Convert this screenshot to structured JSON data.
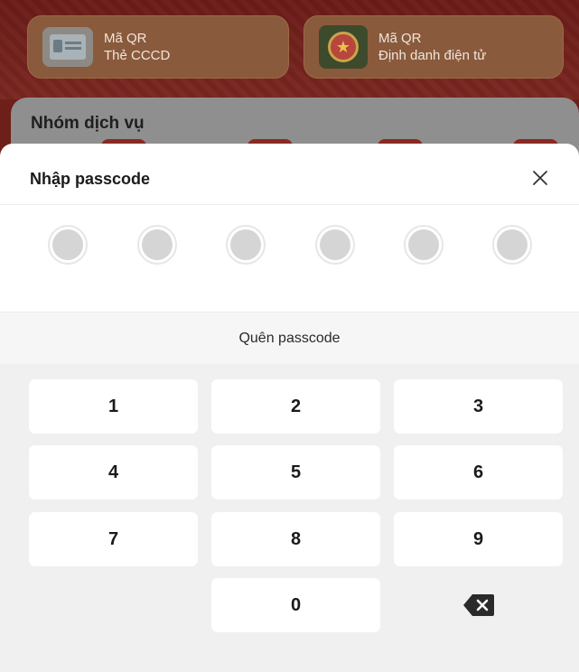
{
  "background": {
    "qr_cards": [
      {
        "title": "Mã QR",
        "subtitle": "Thẻ CCCD",
        "icon": "id-card-icon"
      },
      {
        "title": "Mã QR",
        "subtitle": "Định danh điện tử",
        "icon": "national-emblem-icon"
      }
    ],
    "service_group_title": "Nhóm dịch vụ"
  },
  "passcode_sheet": {
    "title": "Nhập passcode",
    "close_icon": "close-icon",
    "digits_total": 6,
    "digits_entered": 0,
    "forgot_label": "Quên passcode",
    "keys": [
      "1",
      "2",
      "3",
      "4",
      "5",
      "6",
      "7",
      "8",
      "9",
      "0"
    ],
    "delete_icon": "backspace-icon"
  },
  "colors": {
    "brand_red": "#6e1f1a",
    "keypad_bg": "#f0f0f0",
    "dot_fill": "#d5d5d5"
  }
}
